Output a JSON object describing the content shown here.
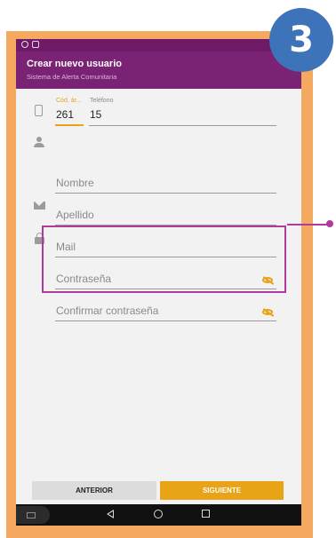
{
  "app": {
    "title": "Crear nuevo usuario",
    "subtitle": "Sistema de Alerta Comunitaria"
  },
  "form": {
    "area_code_label": "Cód. ár...",
    "area_code_value": "261",
    "phone_label": "Teléfono",
    "phone_value": "15",
    "first_name_placeholder": "Nombre",
    "last_name_placeholder": "Apellido",
    "email_placeholder": "Mail",
    "password_placeholder": "Contraseña",
    "confirm_password_placeholder": "Confirmar contraseña"
  },
  "buttons": {
    "previous_label": "ANTERIOR",
    "next_label": "SIGUIENTE"
  },
  "step_badge": "3",
  "icons": {
    "phone": "phone-icon",
    "person": "person-icon",
    "mail": "mail-icon",
    "lock": "lock-icon",
    "visibility_off": "eye-off-icon",
    "nav_back": "back-icon",
    "nav_home": "home-icon",
    "nav_recent": "recent-apps-icon"
  },
  "colors": {
    "app_bar": "#7a2273",
    "accent": "#e8a317",
    "highlight": "#b23a9e",
    "frame": "#f4a860",
    "badge": "#3d73b8"
  }
}
